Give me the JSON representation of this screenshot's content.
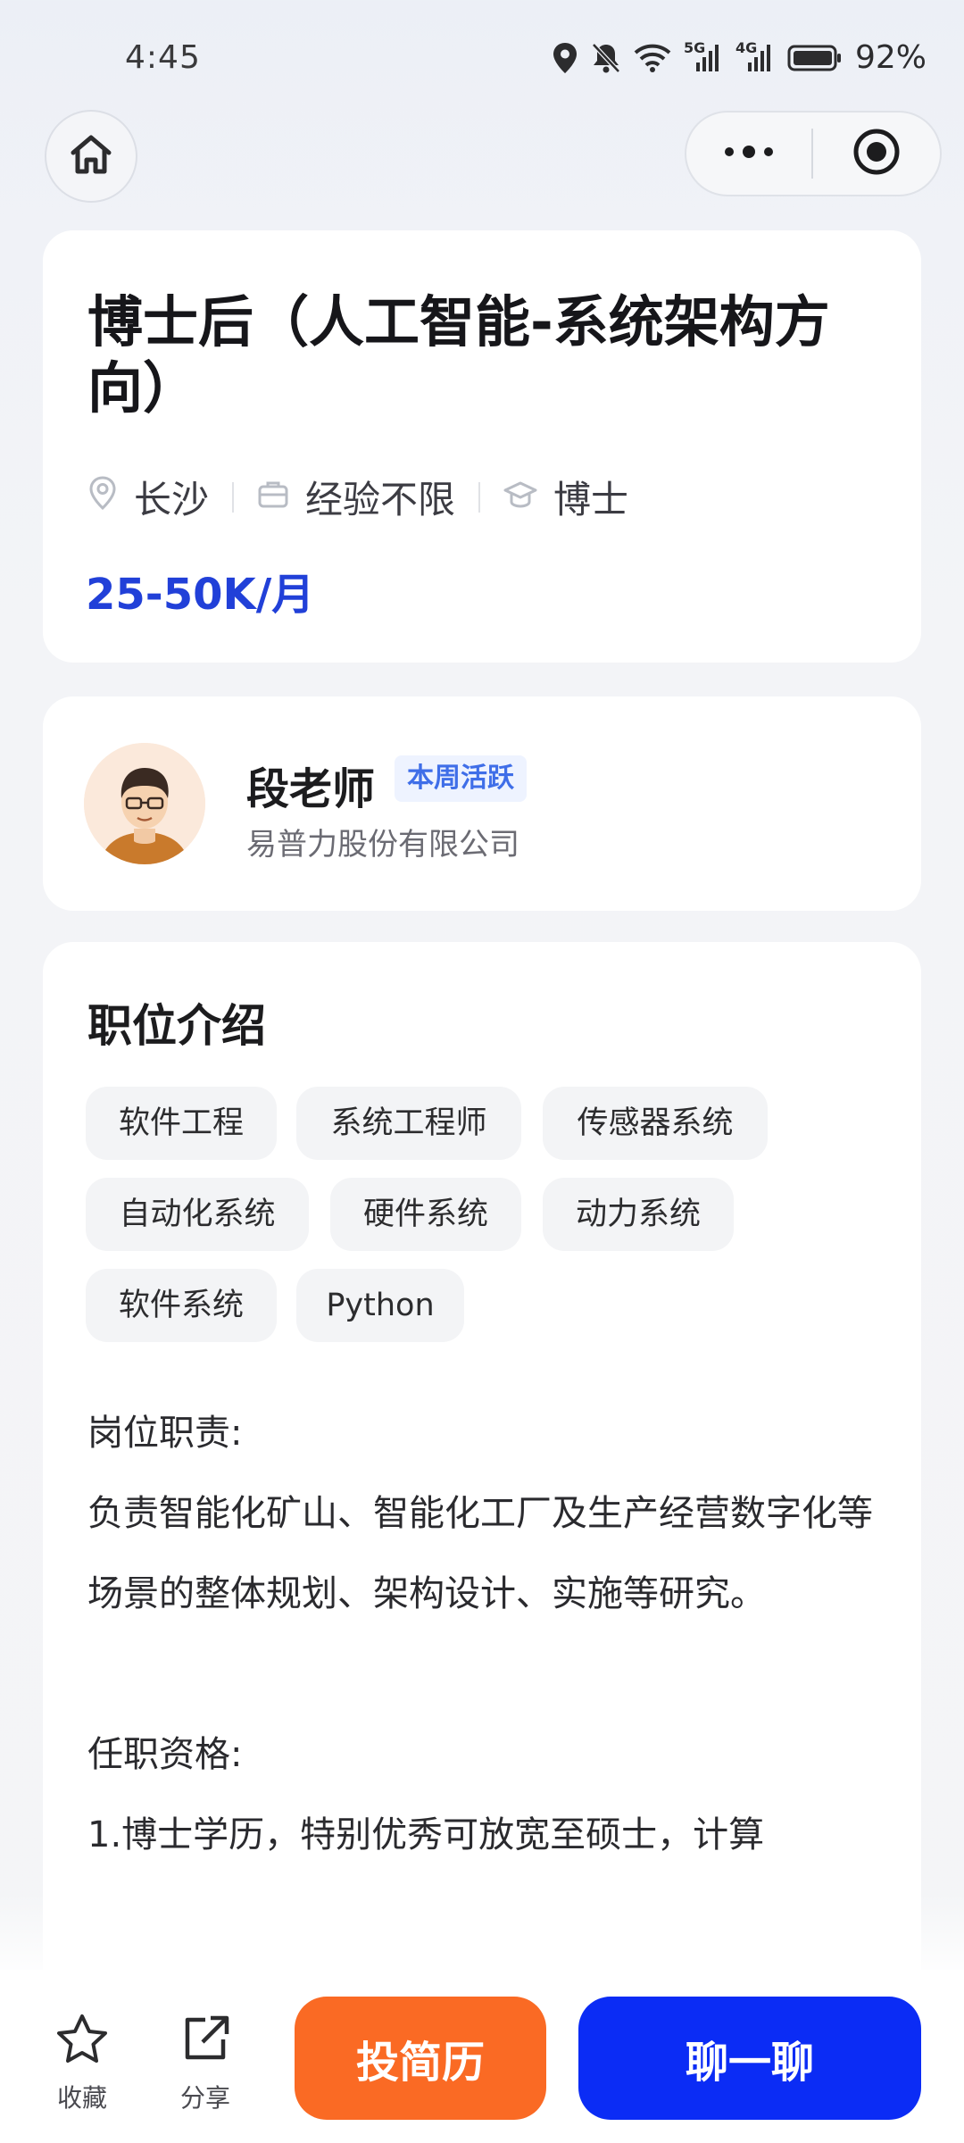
{
  "status_bar": {
    "time": "4:45",
    "battery": "92%",
    "icons": [
      "location-icon",
      "mute-bell-icon",
      "wifi-icon",
      "signal-5g-icon",
      "signal-4g-icon",
      "battery-icon"
    ],
    "net1": "5G",
    "net2": "4G"
  },
  "nav": {
    "icons": [
      "home-icon",
      "more-dots-icon",
      "target-icon"
    ]
  },
  "job": {
    "title": "博士后（人工智能-系统架构方向）",
    "location": "长沙",
    "experience": "经验不限",
    "education": "博士",
    "salary": "25-50K/月",
    "icons": [
      "location-pin-icon",
      "briefcase-icon",
      "graduation-cap-icon"
    ]
  },
  "recruiter": {
    "name": "段老师",
    "badge": "本周活跃",
    "company": "易普力股份有限公司"
  },
  "description": {
    "heading": "职位介绍",
    "tags": [
      "软件工程",
      "系统工程师",
      "传感器系统",
      "自动化系统",
      "硬件系统",
      "动力系统",
      "软件系统",
      "Python"
    ],
    "paragraphs": [
      "岗位职责:",
      "负责智能化矿山、智能化工厂及生产经营数字化等场景的整体规划、架构设计、实施等研究。",
      "",
      "任职资格:",
      "1.博士学历，特别优秀可放宽至硕士，计算"
    ]
  },
  "bottom_bar": {
    "favorite_label": "收藏",
    "share_label": "分享",
    "resume_button": "投简历",
    "chat_button": "聊一聊"
  },
  "colors": {
    "salary": "#2140d8",
    "badge_text": "#3f6ee8",
    "resume_button": "#fa6a24",
    "chat_button": "#0b2cf5"
  }
}
